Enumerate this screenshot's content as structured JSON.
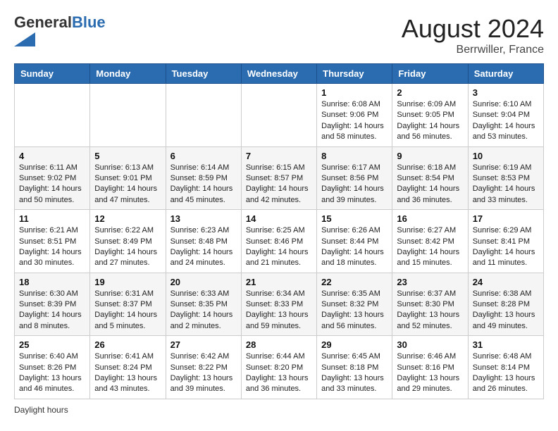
{
  "header": {
    "logo_general": "General",
    "logo_blue": "Blue",
    "month_year": "August 2024",
    "location": "Berrwiller, France"
  },
  "days_of_week": [
    "Sunday",
    "Monday",
    "Tuesday",
    "Wednesday",
    "Thursday",
    "Friday",
    "Saturday"
  ],
  "weeks": [
    [
      {
        "day": "",
        "sunrise": "",
        "sunset": "",
        "daylight": ""
      },
      {
        "day": "",
        "sunrise": "",
        "sunset": "",
        "daylight": ""
      },
      {
        "day": "",
        "sunrise": "",
        "sunset": "",
        "daylight": ""
      },
      {
        "day": "",
        "sunrise": "",
        "sunset": "",
        "daylight": ""
      },
      {
        "day": "1",
        "sunrise": "6:08 AM",
        "sunset": "9:06 PM",
        "daylight": "14 hours and 58 minutes."
      },
      {
        "day": "2",
        "sunrise": "6:09 AM",
        "sunset": "9:05 PM",
        "daylight": "14 hours and 56 minutes."
      },
      {
        "day": "3",
        "sunrise": "6:10 AM",
        "sunset": "9:04 PM",
        "daylight": "14 hours and 53 minutes."
      }
    ],
    [
      {
        "day": "4",
        "sunrise": "6:11 AM",
        "sunset": "9:02 PM",
        "daylight": "14 hours and 50 minutes."
      },
      {
        "day": "5",
        "sunrise": "6:13 AM",
        "sunset": "9:01 PM",
        "daylight": "14 hours and 47 minutes."
      },
      {
        "day": "6",
        "sunrise": "6:14 AM",
        "sunset": "8:59 PM",
        "daylight": "14 hours and 45 minutes."
      },
      {
        "day": "7",
        "sunrise": "6:15 AM",
        "sunset": "8:57 PM",
        "daylight": "14 hours and 42 minutes."
      },
      {
        "day": "8",
        "sunrise": "6:17 AM",
        "sunset": "8:56 PM",
        "daylight": "14 hours and 39 minutes."
      },
      {
        "day": "9",
        "sunrise": "6:18 AM",
        "sunset": "8:54 PM",
        "daylight": "14 hours and 36 minutes."
      },
      {
        "day": "10",
        "sunrise": "6:19 AM",
        "sunset": "8:53 PM",
        "daylight": "14 hours and 33 minutes."
      }
    ],
    [
      {
        "day": "11",
        "sunrise": "6:21 AM",
        "sunset": "8:51 PM",
        "daylight": "14 hours and 30 minutes."
      },
      {
        "day": "12",
        "sunrise": "6:22 AM",
        "sunset": "8:49 PM",
        "daylight": "14 hours and 27 minutes."
      },
      {
        "day": "13",
        "sunrise": "6:23 AM",
        "sunset": "8:48 PM",
        "daylight": "14 hours and 24 minutes."
      },
      {
        "day": "14",
        "sunrise": "6:25 AM",
        "sunset": "8:46 PM",
        "daylight": "14 hours and 21 minutes."
      },
      {
        "day": "15",
        "sunrise": "6:26 AM",
        "sunset": "8:44 PM",
        "daylight": "14 hours and 18 minutes."
      },
      {
        "day": "16",
        "sunrise": "6:27 AM",
        "sunset": "8:42 PM",
        "daylight": "14 hours and 15 minutes."
      },
      {
        "day": "17",
        "sunrise": "6:29 AM",
        "sunset": "8:41 PM",
        "daylight": "14 hours and 11 minutes."
      }
    ],
    [
      {
        "day": "18",
        "sunrise": "6:30 AM",
        "sunset": "8:39 PM",
        "daylight": "14 hours and 8 minutes."
      },
      {
        "day": "19",
        "sunrise": "6:31 AM",
        "sunset": "8:37 PM",
        "daylight": "14 hours and 5 minutes."
      },
      {
        "day": "20",
        "sunrise": "6:33 AM",
        "sunset": "8:35 PM",
        "daylight": "14 hours and 2 minutes."
      },
      {
        "day": "21",
        "sunrise": "6:34 AM",
        "sunset": "8:33 PM",
        "daylight": "13 hours and 59 minutes."
      },
      {
        "day": "22",
        "sunrise": "6:35 AM",
        "sunset": "8:32 PM",
        "daylight": "13 hours and 56 minutes."
      },
      {
        "day": "23",
        "sunrise": "6:37 AM",
        "sunset": "8:30 PM",
        "daylight": "13 hours and 52 minutes."
      },
      {
        "day": "24",
        "sunrise": "6:38 AM",
        "sunset": "8:28 PM",
        "daylight": "13 hours and 49 minutes."
      }
    ],
    [
      {
        "day": "25",
        "sunrise": "6:40 AM",
        "sunset": "8:26 PM",
        "daylight": "13 hours and 46 minutes."
      },
      {
        "day": "26",
        "sunrise": "6:41 AM",
        "sunset": "8:24 PM",
        "daylight": "13 hours and 43 minutes."
      },
      {
        "day": "27",
        "sunrise": "6:42 AM",
        "sunset": "8:22 PM",
        "daylight": "13 hours and 39 minutes."
      },
      {
        "day": "28",
        "sunrise": "6:44 AM",
        "sunset": "8:20 PM",
        "daylight": "13 hours and 36 minutes."
      },
      {
        "day": "29",
        "sunrise": "6:45 AM",
        "sunset": "8:18 PM",
        "daylight": "13 hours and 33 minutes."
      },
      {
        "day": "30",
        "sunrise": "6:46 AM",
        "sunset": "8:16 PM",
        "daylight": "13 hours and 29 minutes."
      },
      {
        "day": "31",
        "sunrise": "6:48 AM",
        "sunset": "8:14 PM",
        "daylight": "13 hours and 26 minutes."
      }
    ]
  ],
  "footer": {
    "note": "Daylight hours"
  }
}
